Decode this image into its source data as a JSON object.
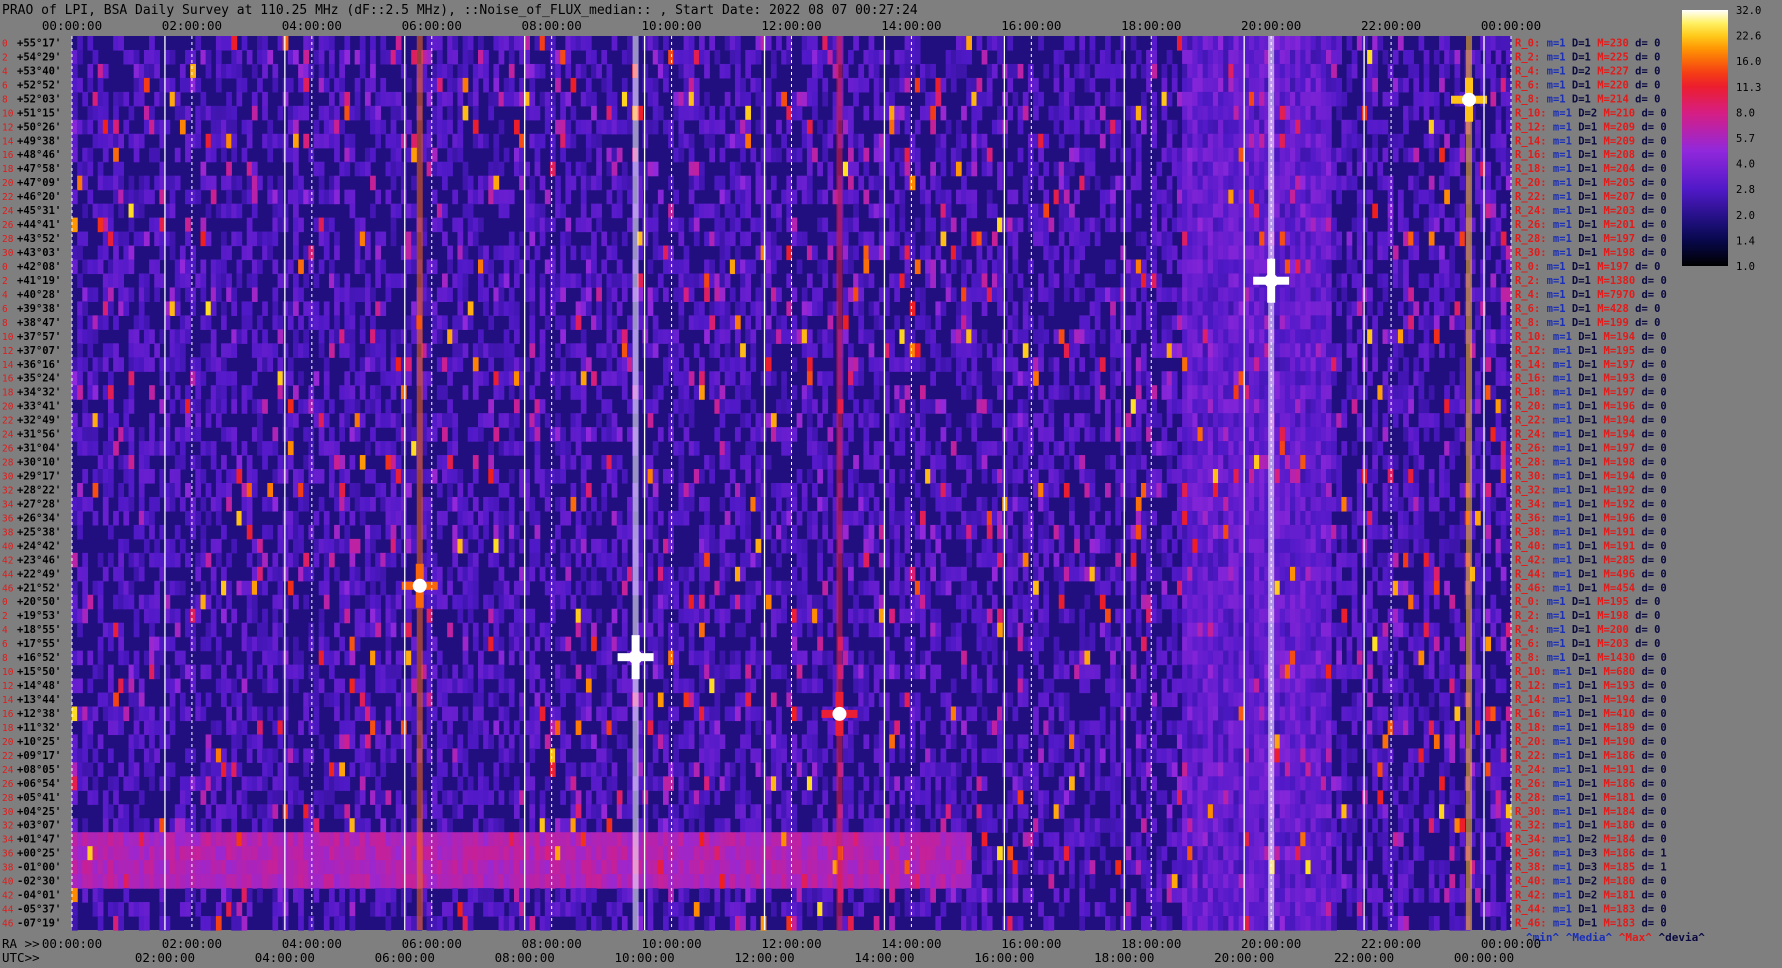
{
  "chart_data": {
    "type": "heatmap",
    "title": "PRAO of LPI, BSA Daily Survey at 110.25 MHz (dF::2.5 MHz), ::Noise_of_FLUX_median:: , Start Date: 2022 08 07 00:27:24",
    "x_ticks_top": [
      "00:00:00",
      "02:00:00",
      "04:00:00",
      "06:00:00",
      "08:00:00",
      "10:00:00",
      "12:00:00",
      "14:00:00",
      "16:00:00",
      "18:00:00",
      "20:00:00",
      "22:00:00",
      "00:00:00"
    ],
    "x_ticks_bottom_ra": [
      "00:00:00",
      "02:00:00",
      "04:00:00",
      "06:00:00",
      "08:00:00",
      "10:00:00",
      "12:00:00",
      "14:00:00",
      "16:00:00",
      "18:00:00",
      "20:00:00",
      "22:00:00",
      "00:00:00"
    ],
    "x_ticks_bottom_utc": [
      "02:00:00",
      "04:00:00",
      "06:00:00",
      "08:00:00",
      "10:00:00",
      "12:00:00",
      "14:00:00",
      "16:00:00",
      "18:00:00",
      "20:00:00",
      "22:00:00",
      "00:00:00"
    ],
    "ra_label": "RA >>",
    "utc_label": "UTC>>",
    "declinations": [
      "+55°17'",
      "+54°29'",
      "+53°40'",
      "+52°52'",
      "+52°03'",
      "+51°15'",
      "+50°26'",
      "+49°38'",
      "+48°46'",
      "+47°58'",
      "+47°09'",
      "+46°20'",
      "+45°31'",
      "+44°41'",
      "+43°52'",
      "+43°03'",
      "+42°08'",
      "+41°19'",
      "+40°28'",
      "+39°38'",
      "+38°47'",
      "+37°57'",
      "+37°07'",
      "+36°16'",
      "+35°24'",
      "+34°32'",
      "+33°41'",
      "+32°49'",
      "+31°56'",
      "+31°04'",
      "+30°10'",
      "+29°17'",
      "+28°22'",
      "+27°28'",
      "+26°34'",
      "+25°38'",
      "+24°42'",
      "+23°46'",
      "+22°49'",
      "+21°52'",
      "+20°50'",
      "+19°53'",
      "+18°55'",
      "+17°55'",
      "+16°52'",
      "+15°50'",
      "+14°48'",
      "+13°44'",
      "+12°38'",
      "+11°32'",
      "+10°25'",
      "+09°17'",
      "+08°05'",
      "+06°54'",
      "+05°41'",
      "+04°25'",
      "+03°07'",
      "+01°47'",
      "+00°25'",
      "-01°00'",
      "-02°30'",
      "-04°01'",
      "-05°37'",
      "-07°19'"
    ],
    "row_index_labels": [
      "0",
      "2",
      "4",
      "6",
      "8",
      "10",
      "12",
      "14",
      "16",
      "18",
      "20",
      "22",
      "24",
      "26",
      "28",
      "30",
      "0",
      "2",
      "4",
      "6",
      "8",
      "10",
      "12",
      "14",
      "16",
      "18",
      "20",
      "22",
      "24",
      "26",
      "28",
      "30",
      "32",
      "34",
      "36",
      "38",
      "40",
      "42",
      "44",
      "46",
      "0",
      "2",
      "4",
      "6",
      "8",
      "10",
      "12",
      "14",
      "16",
      "18",
      "20",
      "22",
      "24",
      "26",
      "28",
      "30",
      "32",
      "34",
      "36",
      "38",
      "40",
      "42",
      "44",
      "46"
    ],
    "row_stats": [
      {
        "R": "R_0:",
        "m": "m=1",
        "D": "D=1",
        "M": "M=230",
        "d": "d= 0"
      },
      {
        "R": "R_2:",
        "m": "m=1",
        "D": "D=1",
        "M": "M=225",
        "d": "d= 0"
      },
      {
        "R": "R_4:",
        "m": "m=1",
        "D": "D=2",
        "M": "M=227",
        "d": "d= 0"
      },
      {
        "R": "R_6:",
        "m": "m=1",
        "D": "D=1",
        "M": "M=220",
        "d": "d= 0"
      },
      {
        "R": "R_8:",
        "m": "m=1",
        "D": "D=1",
        "M": "M=214",
        "d": "d= 0"
      },
      {
        "R": "R_10:",
        "m": "m=1",
        "D": "D=2",
        "M": "M=210",
        "d": "d= 0"
      },
      {
        "R": "R_12:",
        "m": "m=1",
        "D": "D=1",
        "M": "M=209",
        "d": "d= 0"
      },
      {
        "R": "R_14:",
        "m": "m=1",
        "D": "D=1",
        "M": "M=209",
        "d": "d= 0"
      },
      {
        "R": "R_16:",
        "m": "m=1",
        "D": "D=1",
        "M": "M=208",
        "d": "d= 0"
      },
      {
        "R": "R_18:",
        "m": "m=1",
        "D": "D=1",
        "M": "M=204",
        "d": "d= 0"
      },
      {
        "R": "R_20:",
        "m": "m=1",
        "D": "D=1",
        "M": "M=205",
        "d": "d= 0"
      },
      {
        "R": "R_22:",
        "m": "m=1",
        "D": "D=1",
        "M": "M=207",
        "d": "d= 0"
      },
      {
        "R": "R_24:",
        "m": "m=1",
        "D": "D=1",
        "M": "M=203",
        "d": "d= 0"
      },
      {
        "R": "R_26:",
        "m": "m=1",
        "D": "D=1",
        "M": "M=201",
        "d": "d= 0"
      },
      {
        "R": "R_28:",
        "m": "m=1",
        "D": "D=1",
        "M": "M=197",
        "d": "d= 0"
      },
      {
        "R": "R_30:",
        "m": "m=1",
        "D": "D=1",
        "M": "M=198",
        "d": "d= 0"
      },
      {
        "R": "R_0:",
        "m": "m=1",
        "D": "D=1",
        "M": "M=197",
        "d": "d= 0"
      },
      {
        "R": "R_2:",
        "m": "m=1",
        "D": "D=1",
        "M": "M=1380",
        "d": "d= 0"
      },
      {
        "R": "R_4:",
        "m": "m=1",
        "D": "D=1",
        "M": "M=7970",
        "d": "d= 0"
      },
      {
        "R": "R_6:",
        "m": "m=1",
        "D": "D=1",
        "M": "M=428",
        "d": "d= 0"
      },
      {
        "R": "R_8:",
        "m": "m=1",
        "D": "D=1",
        "M": "M=199",
        "d": "d= 0"
      },
      {
        "R": "R_10:",
        "m": "m=1",
        "D": "D=1",
        "M": "M=194",
        "d": "d= 0"
      },
      {
        "R": "R_12:",
        "m": "m=1",
        "D": "D=1",
        "M": "M=195",
        "d": "d= 0"
      },
      {
        "R": "R_14:",
        "m": "m=1",
        "D": "D=1",
        "M": "M=197",
        "d": "d= 0"
      },
      {
        "R": "R_16:",
        "m": "m=1",
        "D": "D=1",
        "M": "M=193",
        "d": "d= 0"
      },
      {
        "R": "R_18:",
        "m": "m=1",
        "D": "D=1",
        "M": "M=197",
        "d": "d= 0"
      },
      {
        "R": "R_20:",
        "m": "m=1",
        "D": "D=1",
        "M": "M=196",
        "d": "d= 0"
      },
      {
        "R": "R_22:",
        "m": "m=1",
        "D": "D=1",
        "M": "M=194",
        "d": "d= 0"
      },
      {
        "R": "R_24:",
        "m": "m=1",
        "D": "D=1",
        "M": "M=194",
        "d": "d= 0"
      },
      {
        "R": "R_26:",
        "m": "m=1",
        "D": "D=1",
        "M": "M=197",
        "d": "d= 0"
      },
      {
        "R": "R_28:",
        "m": "m=1",
        "D": "D=1",
        "M": "M=198",
        "d": "d= 0"
      },
      {
        "R": "R_30:",
        "m": "m=1",
        "D": "D=1",
        "M": "M=194",
        "d": "d= 0"
      },
      {
        "R": "R_32:",
        "m": "m=1",
        "D": "D=1",
        "M": "M=192",
        "d": "d= 0"
      },
      {
        "R": "R_34:",
        "m": "m=1",
        "D": "D=1",
        "M": "M=192",
        "d": "d= 0"
      },
      {
        "R": "R_36:",
        "m": "m=1",
        "D": "D=1",
        "M": "M=196",
        "d": "d= 0"
      },
      {
        "R": "R_38:",
        "m": "m=1",
        "D": "D=1",
        "M": "M=191",
        "d": "d= 0"
      },
      {
        "R": "R_40:",
        "m": "m=1",
        "D": "D=1",
        "M": "M=191",
        "d": "d= 0"
      },
      {
        "R": "R_42:",
        "m": "m=1",
        "D": "D=1",
        "M": "M=285",
        "d": "d= 0"
      },
      {
        "R": "R_44:",
        "m": "m=1",
        "D": "D=1",
        "M": "M=496",
        "d": "d= 0"
      },
      {
        "R": "R_46:",
        "m": "m=1",
        "D": "D=1",
        "M": "M=454",
        "d": "d= 0"
      },
      {
        "R": "R_0:",
        "m": "m=1",
        "D": "D=1",
        "M": "M=195",
        "d": "d= 0"
      },
      {
        "R": "R_2:",
        "m": "m=1",
        "D": "D=1",
        "M": "M=198",
        "d": "d= 0"
      },
      {
        "R": "R_4:",
        "m": "m=1",
        "D": "D=1",
        "M": "M=200",
        "d": "d= 0"
      },
      {
        "R": "R_6:",
        "m": "m=1",
        "D": "D=1",
        "M": "M=203",
        "d": "d= 0"
      },
      {
        "R": "R_8:",
        "m": "m=1",
        "D": "D=1",
        "M": "M=1430",
        "d": "d= 0"
      },
      {
        "R": "R_10:",
        "m": "m=1",
        "D": "D=1",
        "M": "M=680",
        "d": "d= 0"
      },
      {
        "R": "R_12:",
        "m": "m=1",
        "D": "D=1",
        "M": "M=193",
        "d": "d= 0"
      },
      {
        "R": "R_14:",
        "m": "m=1",
        "D": "D=1",
        "M": "M=194",
        "d": "d= 0"
      },
      {
        "R": "R_16:",
        "m": "m=1",
        "D": "D=1",
        "M": "M=410",
        "d": "d= 0"
      },
      {
        "R": "R_18:",
        "m": "m=1",
        "D": "D=1",
        "M": "M=189",
        "d": "d= 0"
      },
      {
        "R": "R_20:",
        "m": "m=1",
        "D": "D=1",
        "M": "M=190",
        "d": "d= 0"
      },
      {
        "R": "R_22:",
        "m": "m=1",
        "D": "D=1",
        "M": "M=186",
        "d": "d= 0"
      },
      {
        "R": "R_24:",
        "m": "m=1",
        "D": "D=1",
        "M": "M=191",
        "d": "d= 0"
      },
      {
        "R": "R_26:",
        "m": "m=1",
        "D": "D=1",
        "M": "M=186",
        "d": "d= 0"
      },
      {
        "R": "R_28:",
        "m": "m=1",
        "D": "D=1",
        "M": "M=181",
        "d": "d= 0"
      },
      {
        "R": "R_30:",
        "m": "m=1",
        "D": "D=1",
        "M": "M=184",
        "d": "d= 0"
      },
      {
        "R": "R_32:",
        "m": "m=1",
        "D": "D=1",
        "M": "M=180",
        "d": "d= 0"
      },
      {
        "R": "R_34:",
        "m": "m=1",
        "D": "D=2",
        "M": "M=184",
        "d": "d= 0"
      },
      {
        "R": "R_36:",
        "m": "m=1",
        "D": "D=3",
        "M": "M=186",
        "d": "d= 1"
      },
      {
        "R": "R_38:",
        "m": "m=1",
        "D": "D=3",
        "M": "M=185",
        "d": "d= 1"
      },
      {
        "R": "R_40:",
        "m": "m=1",
        "D": "D=2",
        "M": "M=180",
        "d": "d= 0"
      },
      {
        "R": "R_42:",
        "m": "m=1",
        "D": "D=2",
        "M": "M=181",
        "d": "d= 0"
      },
      {
        "R": "R_44:",
        "m": "m=1",
        "D": "D=1",
        "M": "M=183",
        "d": "d= 0"
      },
      {
        "R": "R_46:",
        "m": "m=1",
        "D": "D=1",
        "M": "M=183",
        "d": "d= 0"
      }
    ],
    "stats_legend": [
      {
        "text": "^min^",
        "color": "#1a2fb8"
      },
      {
        "text": "^Media^",
        "color": "#1a2fb8"
      },
      {
        "text": "^Max^",
        "color": "#e21b1b"
      },
      {
        "text": "^devia^",
        "color": "#0a0a40"
      }
    ],
    "colorbar_ticks": [
      "32.0",
      "22.6",
      "16.0",
      "11.3",
      "8.0",
      "5.7",
      "4.0",
      "2.8",
      "2.0",
      "1.4",
      "1.0"
    ],
    "colorbar_range": [
      1.0,
      32.0
    ],
    "colorbar_scale": "log",
    "colormap": "gnuplot2-like (black-navy-violet-purple-red-orange-yellow-white)",
    "features": [
      {
        "name": "bright source",
        "ra_hours": 20.0,
        "dec_deg": 41.3,
        "level": 32
      },
      {
        "name": "bright source",
        "ra_hours": 9.4,
        "dec_deg": 16.9,
        "level": 32
      },
      {
        "name": "bright source",
        "ra_hours": 23.3,
        "dec_deg": 52.0,
        "level": 22
      },
      {
        "name": "source",
        "ra_hours": 5.8,
        "dec_deg": 22.0,
        "level": 16
      },
      {
        "name": "source",
        "ra_hours": 12.8,
        "dec_deg": 12.6,
        "level": 11
      },
      {
        "name": "band",
        "dec_range": [
          -2.5,
          1.8
        ],
        "ra_range": [
          0,
          15
        ],
        "level": 6
      },
      {
        "name": "galactic plane",
        "ra_range": [
          18.5,
          21.0
        ],
        "level": 5
      }
    ],
    "colors": {
      "background": "#7f7f7f",
      "stat_R": "#e21b1b",
      "stat_m": "#1a2fb8",
      "stat_D": "#0a0a40",
      "stat_M": "#e21b1b",
      "stat_d": "#0a0a40",
      "gridline": "#ffffff"
    }
  }
}
